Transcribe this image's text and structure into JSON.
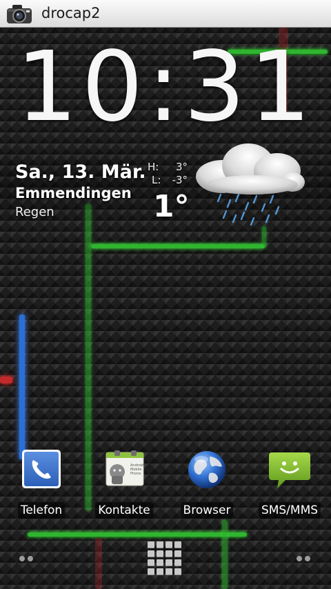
{
  "statusbar": {
    "app_title": "drocap2",
    "app_icon": "camera-icon"
  },
  "clock": {
    "time": "10:31"
  },
  "weather": {
    "date": "Sa., 13. Mär.",
    "city": "Emmendingen",
    "condition": "Regen",
    "high_label": "H:",
    "high_value": "3°",
    "low_label": "L:",
    "low_value": "-3°",
    "temperature": "1°",
    "icon": "rain-cloud-icon"
  },
  "dock": {
    "items": [
      {
        "label": "Telefon",
        "icon": "phone-icon"
      },
      {
        "label": "Kontakte",
        "icon": "contacts-icon"
      },
      {
        "label": "Browser",
        "icon": "globe-icon"
      },
      {
        "label": "SMS/MMS",
        "icon": "sms-icon"
      }
    ]
  },
  "contacts_card": {
    "line1": "Android",
    "line2": "Mobile",
    "line3": "Phone"
  },
  "navigation": {
    "left_indicator": "page-indicator-left",
    "center_button": "app-drawer-icon",
    "right_indicator": "page-indicator-right"
  },
  "colors": {
    "status_bar": "#e8e8e8",
    "wallpaper": "#1d1d1d",
    "trail_green": "#2fb52f",
    "trail_red": "#c02a2a",
    "trail_blue": "#2a6fd6",
    "text": "#ffffff"
  }
}
